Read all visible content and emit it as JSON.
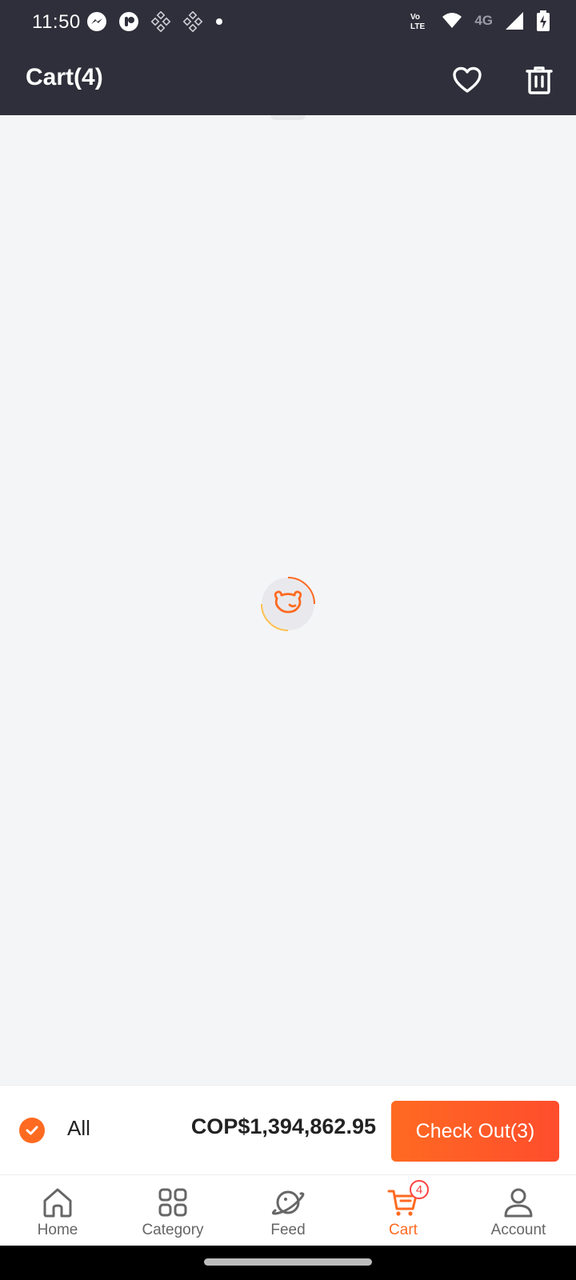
{
  "status_bar": {
    "time": "11:50",
    "network_label": "4G",
    "left_icons": [
      "messenger-icon",
      "app-icon",
      "network-icon",
      "network-icon",
      "dot-icon"
    ],
    "right_icons": [
      "volte-icon",
      "wifi-icon",
      "signal-icon",
      "battery-charging-icon"
    ]
  },
  "header": {
    "title": "Cart(4)",
    "favorite_icon": "heart-icon",
    "delete_icon": "trash-icon"
  },
  "content": {
    "state": "loading",
    "loader_icon": "bear-face-spinner-icon"
  },
  "checkout_bar": {
    "select_all_label": "All",
    "select_all_checked": true,
    "total": "COP$1,394,862.95",
    "checkout_label": "Check Out(3)"
  },
  "bottom_nav": {
    "items": [
      {
        "label": "Home",
        "icon": "home-icon"
      },
      {
        "label": "Category",
        "icon": "grid-icon"
      },
      {
        "label": "Feed",
        "icon": "planet-icon"
      },
      {
        "label": "Cart",
        "icon": "cart-icon",
        "badge": "4",
        "active": true
      },
      {
        "label": "Account",
        "icon": "user-icon"
      }
    ]
  },
  "colors": {
    "header_bg": "#2e2f3a",
    "accent": "#ff6a21",
    "badge": "#ff4040",
    "background": "#f4f5f7"
  }
}
